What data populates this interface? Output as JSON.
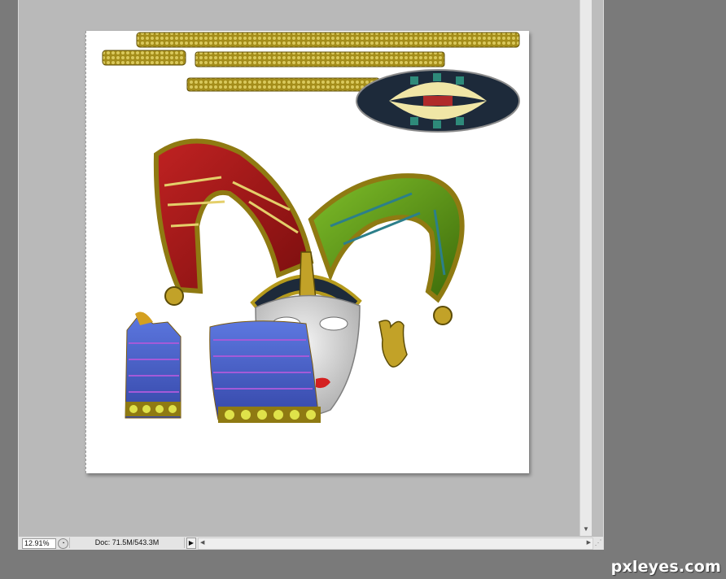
{
  "status_bar": {
    "zoom": "12.91%",
    "doc_info": "Doc: 71.5M/543.3M"
  },
  "watermark": "pxleyes.com",
  "colors": {
    "workspace": "#7a7a7a",
    "canvas_bg": "#ffffff",
    "hat_red": "#a51818",
    "hat_green": "#4f8b12",
    "gold": "#b59a1c",
    "fabric_blue": "#4660c8"
  },
  "icons": {
    "zoom": "zoom-circle-icon",
    "status_menu": "triangle-right-icon"
  }
}
